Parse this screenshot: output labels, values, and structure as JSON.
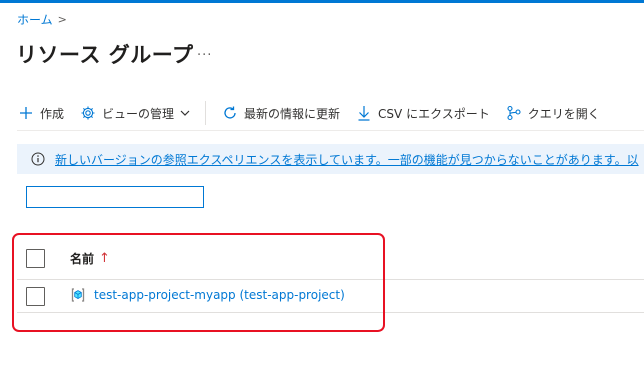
{
  "breadcrumb": {
    "home": "ホーム",
    "separator": ">"
  },
  "page": {
    "title": "リソース グループ",
    "more": "..."
  },
  "toolbar": {
    "create": "作成",
    "manage_view": "ビューの管理",
    "refresh": "最新の情報に更新",
    "export_csv": "CSV にエクスポート",
    "query": "クエリを開く"
  },
  "banner": {
    "text": "新しいバージョンの参照エクスペリエンスを表示しています。一部の機能が見つからないことがあります。以"
  },
  "filter": {
    "value": "",
    "placeholder": ""
  },
  "grid": {
    "columns": [
      {
        "label": "名前",
        "sort": "↑"
      }
    ],
    "rows": [
      {
        "name": "test-app-project-myapp (test-app-project)"
      }
    ]
  },
  "colors": {
    "accent": "#0078d4",
    "highlight": "#e81123",
    "banner_bg": "#ebf3fc"
  },
  "icons": {
    "create": "plus-icon",
    "manage_view": "gear-icon",
    "refresh": "refresh-icon",
    "export": "download-icon",
    "query": "query-icon",
    "info": "info-icon",
    "resource_group": "resource-group-icon"
  }
}
